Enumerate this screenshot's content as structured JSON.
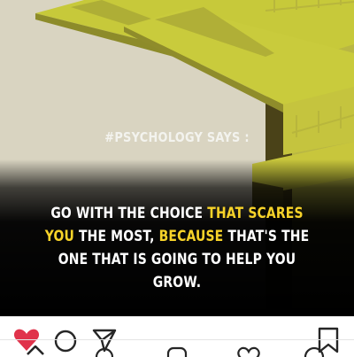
{
  "post": {
    "hashtag": "#PSYCHOLOGY SAYS :",
    "quote": {
      "segments": [
        {
          "text": "GO WITH THE CHOICE ",
          "highlight": false
        },
        {
          "text": "THAT SCARES YOU",
          "highlight": true
        },
        {
          "text": " THE MOST, ",
          "highlight": false
        },
        {
          "text": "BECAUSE",
          "highlight": true
        },
        {
          "text": " THAT'S THE ONE THAT IS GOING TO HELP YOU GROW.",
          "highlight": false
        }
      ]
    },
    "colors": {
      "highlight": "#f7d329",
      "text": "#ffffff",
      "sky": "#d9d4c1",
      "structure": "#c7c93a",
      "like_heart": "#e0334b"
    }
  },
  "actions": {
    "icons": [
      "heart-icon",
      "comment-icon",
      "share-icon",
      "bookmark-icon"
    ]
  },
  "bottom_nav": {
    "icons": [
      "home-icon",
      "search-icon",
      "add-post-icon",
      "activity-heart-icon",
      "profile-icon"
    ]
  }
}
